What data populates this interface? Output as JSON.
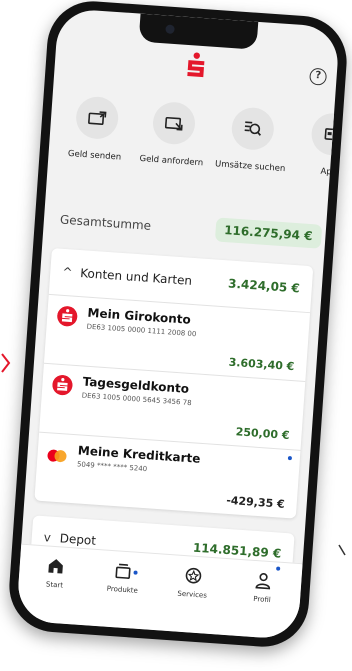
{
  "header": {
    "logo": "sparkasse-logo",
    "help_icon": "help-icon",
    "help_glyph": "?"
  },
  "quick_actions": [
    {
      "label": "Geld senden",
      "icon": "send-money-icon"
    },
    {
      "label": "Geld anfordern",
      "icon": "request-money-icon"
    },
    {
      "label": "Umsätze suchen",
      "icon": "search-transactions-icon"
    },
    {
      "label": "Appl",
      "icon": "card-icon"
    }
  ],
  "total": {
    "label": "Gesamtsumme",
    "amount": "116.275,94 €"
  },
  "accounts_group": {
    "title": "Konten und Karten",
    "amount": "3.424,05 €",
    "expanded": true,
    "chevron": "^",
    "items": [
      {
        "name": "Mein Girokonto",
        "iban": "DE63 1005 0000 1111 2008 00",
        "amount": "3.603,40 €",
        "icon": "sparkasse-icon"
      },
      {
        "name": "Tagesgeldkonto",
        "iban": "DE63 1005 0000 5645 3456 78",
        "amount": "250,00 €",
        "icon": "sparkasse-icon"
      },
      {
        "name": "Meine Kreditkarte",
        "iban": "5049 **** **** 5240",
        "amount": "-429,35 €",
        "icon": "mastercard-icon"
      }
    ]
  },
  "depot": {
    "title": "Depot",
    "amount": "114.851,89 €",
    "chevron": "v"
  },
  "tabbar": [
    {
      "label": "Start",
      "icon": "home-icon"
    },
    {
      "label": "Produkte",
      "icon": "products-icon"
    },
    {
      "label": "Services",
      "icon": "services-icon"
    },
    {
      "label": "Profil",
      "icon": "profile-icon"
    }
  ],
  "colors": {
    "brand_red": "#e4172b",
    "positive_green": "#2e6d2b",
    "badge_bg": "#ddeedd",
    "notification_blue": "#1a56c8"
  }
}
